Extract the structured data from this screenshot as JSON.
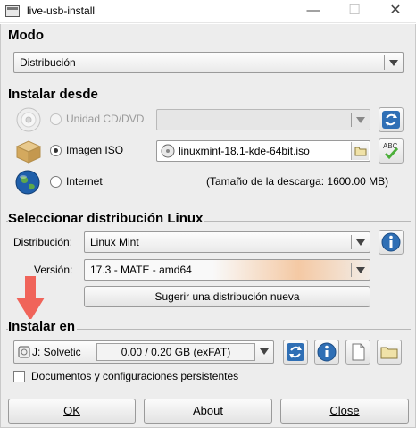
{
  "window": {
    "title": "live-usb-install",
    "minimize": "—",
    "maximize": "☐",
    "close": "✕"
  },
  "modo": {
    "heading": "Modo",
    "value": "Distribución"
  },
  "instalar_desde": {
    "heading": "Instalar desde",
    "cd": {
      "label": "Unidad CD/DVD",
      "value": ""
    },
    "iso": {
      "label": "Imagen ISO",
      "value": "linuxmint-18.1-kde-64bit.iso"
    },
    "internet": {
      "label": "Internet",
      "download_size": "(Tamaño de la descarga: 1600.00 MB)"
    }
  },
  "distribucion": {
    "heading": "Seleccionar distribución Linux",
    "distro_label": "Distribución:",
    "distro_value": "Linux Mint",
    "version_label": "Versión:",
    "version_value": "17.3 - MATE - amd64",
    "suggest_button": "Sugerir una distribución nueva"
  },
  "instalar_en": {
    "heading": "Instalar en",
    "drive": "J: Solvetic",
    "capacity": "0.00 / 0.20 GB (exFAT)",
    "persistent_label": "Documentos y configuraciones persistentes",
    "persistent_checked": false
  },
  "buttons": {
    "ok": "OK",
    "about": "About",
    "close": "Close"
  },
  "colors": {
    "accent_blue": "#2f6fb5",
    "arrow_red": "#f0645a",
    "check_green": "#4caf3a"
  }
}
